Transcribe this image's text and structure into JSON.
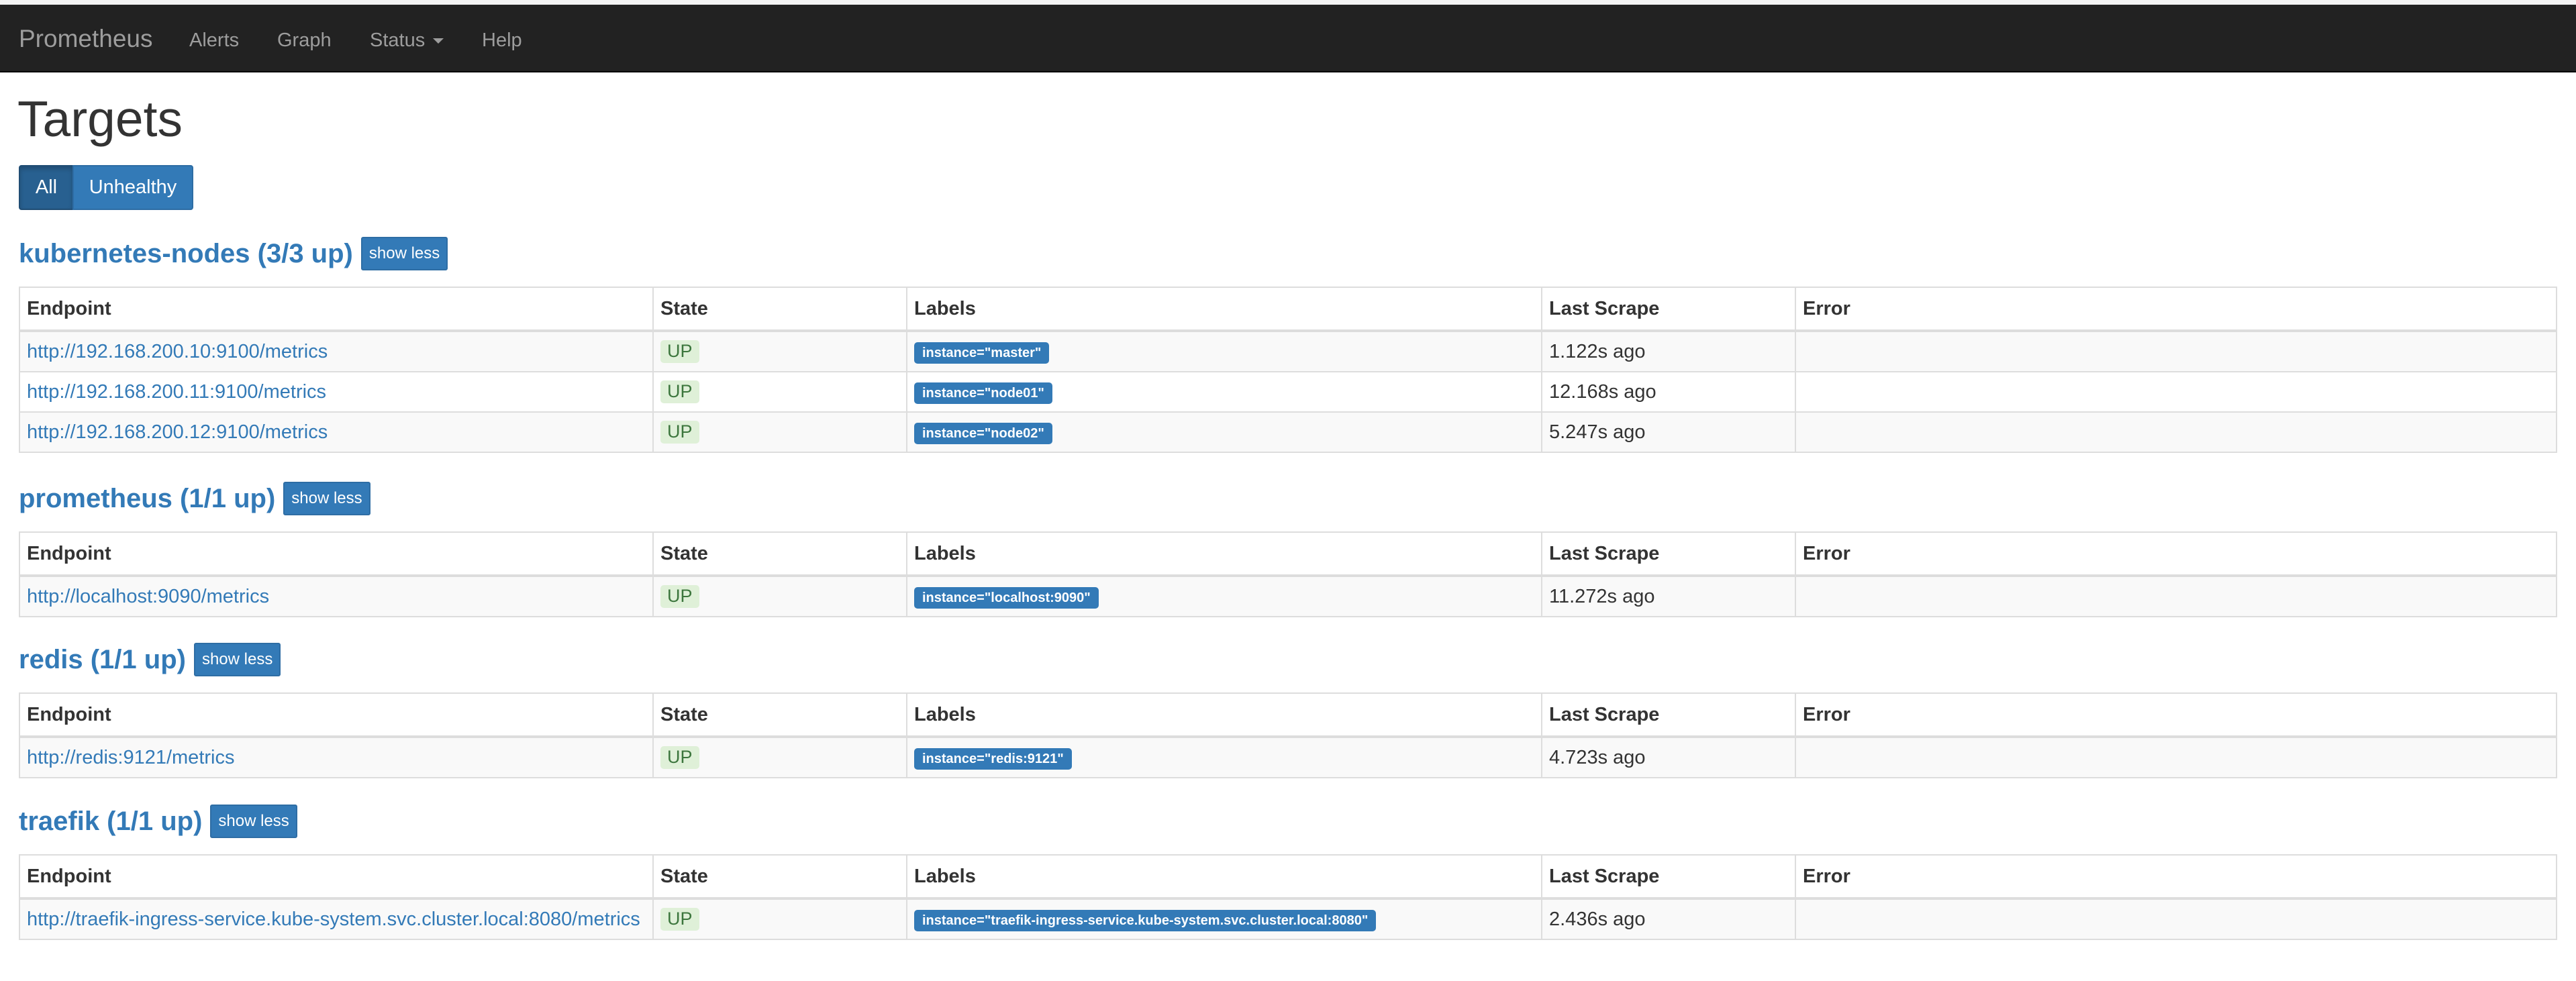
{
  "navbar": {
    "brand": "Prometheus",
    "links": [
      "Alerts",
      "Graph",
      "Status",
      "Help"
    ]
  },
  "page_title": "Targets",
  "filters": {
    "all": "All",
    "unhealthy": "Unhealthy"
  },
  "table_headers": {
    "endpoint": "Endpoint",
    "state": "State",
    "labels": "Labels",
    "last_scrape": "Last Scrape",
    "error": "Error"
  },
  "jobs": [
    {
      "title": "kubernetes-nodes (3/3 up)",
      "toggle": "show less",
      "rows": [
        {
          "endpoint": "http://192.168.200.10:9100/metrics",
          "state": "UP",
          "label": "instance=\"master\"",
          "last_scrape": "1.122s ago",
          "error": ""
        },
        {
          "endpoint": "http://192.168.200.11:9100/metrics",
          "state": "UP",
          "label": "instance=\"node01\"",
          "last_scrape": "12.168s ago",
          "error": ""
        },
        {
          "endpoint": "http://192.168.200.12:9100/metrics",
          "state": "UP",
          "label": "instance=\"node02\"",
          "last_scrape": "5.247s ago",
          "error": ""
        }
      ]
    },
    {
      "title": "prometheus (1/1 up)",
      "toggle": "show less",
      "rows": [
        {
          "endpoint": "http://localhost:9090/metrics",
          "state": "UP",
          "label": "instance=\"localhost:9090\"",
          "last_scrape": "11.272s ago",
          "error": ""
        }
      ]
    },
    {
      "title": "redis (1/1 up)",
      "toggle": "show less",
      "rows": [
        {
          "endpoint": "http://redis:9121/metrics",
          "state": "UP",
          "label": "instance=\"redis:9121\"",
          "last_scrape": "4.723s ago",
          "error": ""
        }
      ]
    },
    {
      "title": "traefik (1/1 up)",
      "toggle": "show less",
      "rows": [
        {
          "endpoint": "http://traefik-ingress-service.kube-system.svc.cluster.local:8080/metrics",
          "state": "UP",
          "label": "instance=\"traefik-ingress-service.kube-system.svc.cluster.local:8080\"",
          "last_scrape": "2.436s ago",
          "error": ""
        }
      ]
    }
  ]
}
